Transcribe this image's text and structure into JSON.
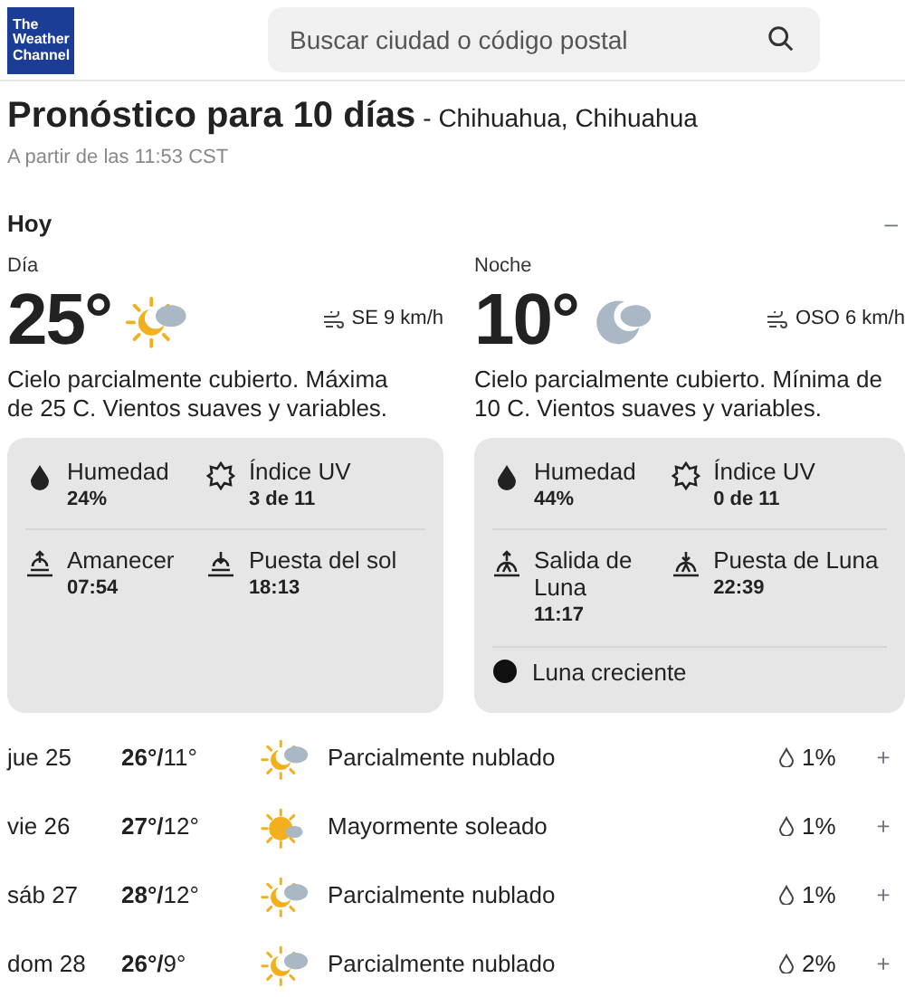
{
  "header": {
    "logo_lines": [
      "The",
      "Weather",
      "Channel"
    ],
    "search": {
      "placeholder": "Buscar ciudad o código postal"
    }
  },
  "page": {
    "title": "Pronóstico para 10 días",
    "location": "- Chihuahua, Chihuahua",
    "updated": "A partir de las 11:53 CST"
  },
  "today": {
    "label": "Hoy",
    "toggle": "–",
    "periods": [
      {
        "label": "Día",
        "temp": "25°",
        "kind": "partly-cloudy-day",
        "wind": "SE 9 km/h",
        "description": "Cielo parcialmente cubierto. Máxima de 25 C. Vientos suaves y variables.",
        "details": [
          {
            "kind": "humidity",
            "label": "Humedad",
            "value": "24%"
          },
          {
            "kind": "uv",
            "label": "Índice UV",
            "value": "3 de 11"
          },
          {
            "kind": "sunrise",
            "label": "Amanecer",
            "value": "07:54"
          },
          {
            "kind": "sunset",
            "label": "Puesta del sol",
            "value": "18:13"
          }
        ]
      },
      {
        "label": "Noche",
        "temp": "10°",
        "kind": "partly-cloudy-night",
        "wind": "OSO 6 km/h",
        "description": "Cielo parcialmente cubierto. Mínima de 10 C. Vientos suaves y variables.",
        "details": [
          {
            "kind": "humidity",
            "label": "Humedad",
            "value": "44%"
          },
          {
            "kind": "uv",
            "label": "Índice UV",
            "value": "0 de 11"
          },
          {
            "kind": "moonrise",
            "label": "Salida de Luna",
            "value": "11:17"
          },
          {
            "kind": "moonset",
            "label": "Puesta de Luna",
            "value": "22:39"
          }
        ],
        "moon_phase": "Luna creciente"
      }
    ]
  },
  "days": [
    {
      "day": "jue 25",
      "temps": "**26°/**11°",
      "kind": "partly-cloudy-day",
      "condition": "Parcialmente nublado",
      "precip": "1%",
      "expand": "+"
    },
    {
      "day": "vie 26",
      "temps": "**27°/**12°",
      "kind": "mostly-sunny",
      "condition": "Mayormente soleado",
      "precip": "1%",
      "expand": "+"
    },
    {
      "day": "sáb 27",
      "temps": "**28°/**12°",
      "kind": "partly-cloudy-day",
      "condition": "Parcialmente nublado",
      "precip": "1%",
      "expand": "+"
    },
    {
      "day": "dom 28",
      "temps": "**26°/**9°",
      "kind": "partly-cloudy-day",
      "condition": "Parcialmente nublado",
      "precip": "2%",
      "expand": "+"
    }
  ]
}
